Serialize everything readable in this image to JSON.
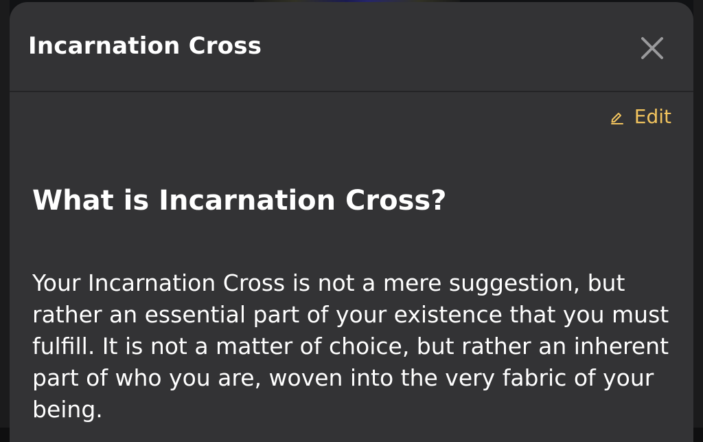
{
  "modal": {
    "title": "Incarnation Cross",
    "close_icon": "close-icon",
    "edit_label": "Edit",
    "edit_icon": "pencil-icon"
  },
  "content": {
    "heading": "What is Incarnation Cross?",
    "body": "Your Incarnation Cross is not a mere suggestion, but rather an essential part of your existence that you must fulfill. It is not a matter of choice, but rather an inherent part of who you are, woven into the very fabric of your being."
  },
  "colors": {
    "sheet_background": "#333335",
    "accent": "#f2c45e",
    "text": "#ffffff"
  }
}
